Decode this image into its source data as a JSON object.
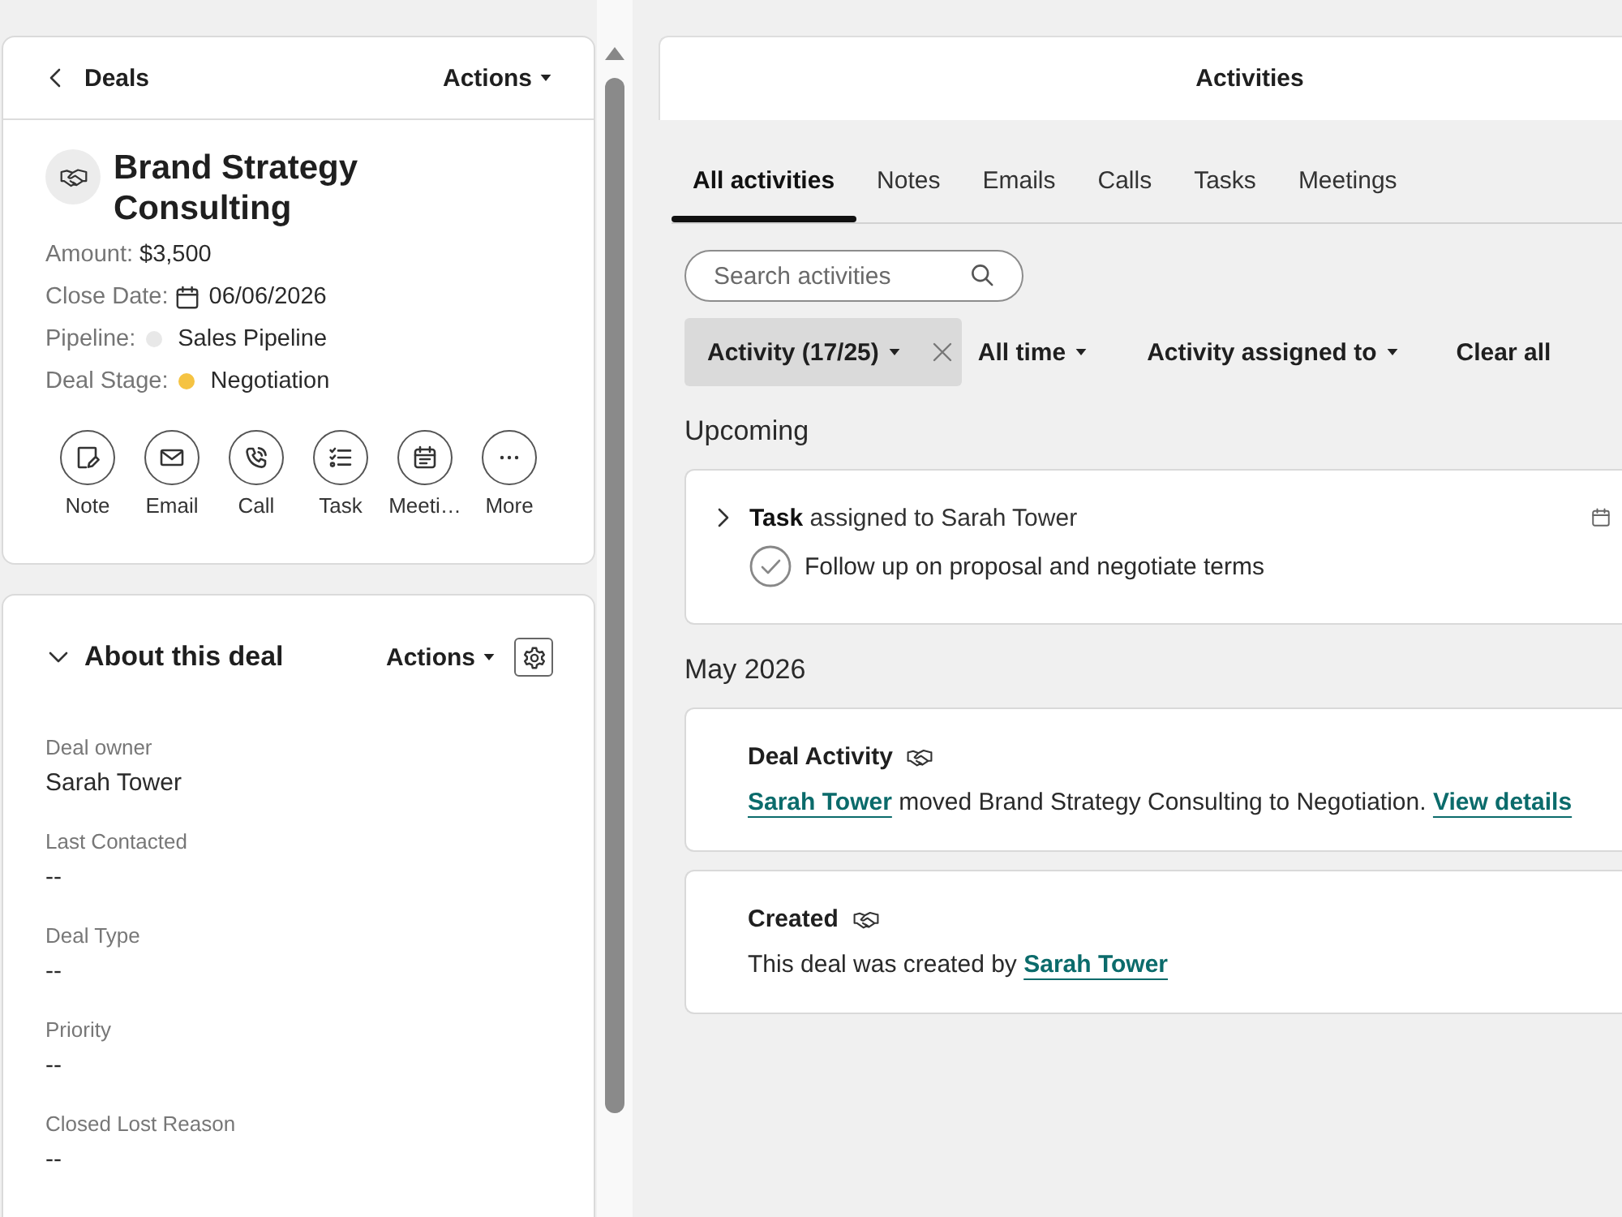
{
  "deal_panel": {
    "header": {
      "back": "Deals",
      "actions": "Actions"
    },
    "record": {
      "title": "Brand Strategy Consulting",
      "fields": [
        {
          "kind": "text",
          "label": "Amount:",
          "value": "$3,500"
        },
        {
          "kind": "date",
          "label": "Close Date:",
          "value": "06/06/2026"
        },
        {
          "kind": "status",
          "label": "Pipeline:",
          "value": "Sales Pipeline",
          "color": "#e8e8e8"
        },
        {
          "kind": "status",
          "label": "Deal Stage:",
          "value": "Negotiation",
          "color": "#f5c342"
        }
      ],
      "quick_actions": [
        {
          "kind": "note",
          "label": "Note"
        },
        {
          "kind": "email",
          "label": "Email"
        },
        {
          "kind": "call",
          "label": "Call"
        },
        {
          "kind": "task",
          "label": "Task"
        },
        {
          "kind": "meeting",
          "label": "Meeti…"
        },
        {
          "kind": "more",
          "label": "More"
        }
      ]
    },
    "about": {
      "title": "About this deal",
      "expanded": true,
      "actions": "Actions",
      "properties": [
        {
          "label": "Deal owner",
          "value": "Sarah Tower"
        },
        {
          "label": "Last Contacted",
          "value": "--"
        },
        {
          "label": "Deal Type",
          "value": "--"
        },
        {
          "label": "Priority",
          "value": "--"
        },
        {
          "label": "Closed Lost Reason",
          "value": "--"
        }
      ]
    }
  },
  "activities": {
    "title": "Activities",
    "tabs": [
      {
        "label": "All activities",
        "selected": true
      },
      {
        "label": "Notes",
        "selected": false
      },
      {
        "label": "Emails",
        "selected": false
      },
      {
        "label": "Calls",
        "selected": false
      },
      {
        "label": "Tasks",
        "selected": false
      },
      {
        "label": "Meetings",
        "selected": false
      }
    ],
    "search": {
      "placeholder": "Search activities"
    },
    "filters": [
      {
        "label": "Activity (17/25)",
        "active": true
      },
      {
        "label": "All time",
        "active": false
      },
      {
        "label": "Activity assigned to",
        "active": false
      }
    ],
    "clear_all": "Clear all",
    "groups": [
      {
        "heading": "Upcoming",
        "items": [
          {
            "kind": "task",
            "title": "**Task** assigned to Sarah Tower",
            "expanded": false,
            "completed": false,
            "task": "Follow up on proposal and negotiate terms"
          }
        ]
      },
      {
        "heading": "May 2026",
        "items": [
          {
            "kind": "event",
            "title": "Deal Activity",
            "body": [
              {
                "kind": "person",
                "text": "Sarah Tower"
              },
              {
                "kind": "text",
                "text": "moved Brand Strategy Consulting to Negotiation."
              },
              {
                "kind": "link",
                "text": "View details"
              }
            ]
          },
          {
            "kind": "event",
            "title": "Created",
            "body": [
              {
                "kind": "text",
                "text": "This deal was created by"
              },
              {
                "kind": "person",
                "text": "Sarah Tower"
              }
            ]
          }
        ]
      }
    ]
  }
}
